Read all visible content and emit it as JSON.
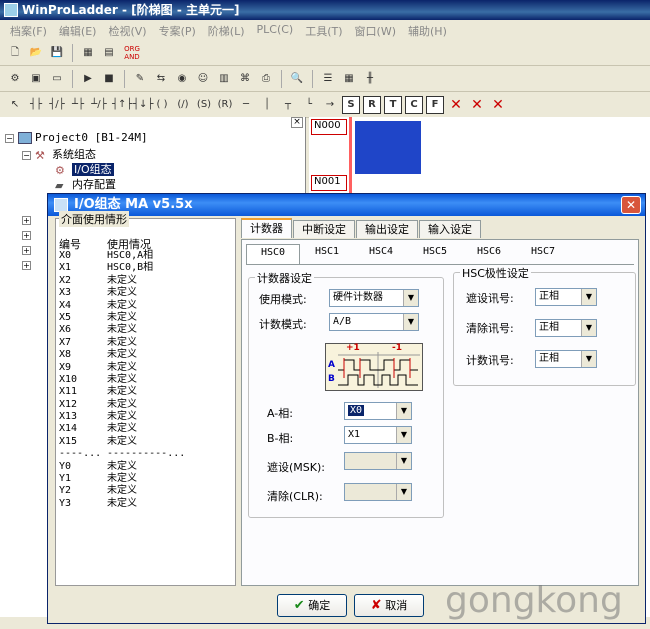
{
  "app": {
    "title": "WinProLadder - [阶梯图 - 主单元一]"
  },
  "menu": [
    "档案(F)",
    "编辑(E)",
    "检视(V)",
    "专案(P)",
    "阶梯(L)",
    "PLC(C)",
    "工具(T)",
    "窗口(W)",
    "辅助(H)"
  ],
  "toolbar3": {
    "b1": "S",
    "b2": "R",
    "b3": "T",
    "b4": "C",
    "b5": "F",
    "t_org": "ORG",
    "t_and": "AND"
  },
  "tree": {
    "project": "Project0  [B1-24M]",
    "system_config": "系统组态",
    "io_config": "I/O组态",
    "memory_config": "内存配置",
    "collapse": "□",
    "close": "×"
  },
  "ladder": {
    "n1": "N000",
    "n2": "N001"
  },
  "dialog": {
    "title": "I/O组态 MA v5.5x",
    "io_group_label": "介面使用情形",
    "col_no": "编号",
    "col_usage": "使用情况",
    "rows": [
      [
        "X0",
        "HSC0,A相"
      ],
      [
        "X1",
        "HSC0,B相"
      ],
      [
        "X2",
        "未定义"
      ],
      [
        "X3",
        "未定义"
      ],
      [
        "X4",
        "未定义"
      ],
      [
        "X5",
        "未定义"
      ],
      [
        "X6",
        "未定义"
      ],
      [
        "X7",
        "未定义"
      ],
      [
        "X8",
        "未定义"
      ],
      [
        "X9",
        "未定义"
      ],
      [
        "X10",
        "未定义"
      ],
      [
        "X11",
        "未定义"
      ],
      [
        "X12",
        "未定义"
      ],
      [
        "X13",
        "未定义"
      ],
      [
        "X14",
        "未定义"
      ],
      [
        "X15",
        "未定义"
      ],
      [
        "----...",
        "----------..."
      ],
      [
        "Y0",
        "未定义"
      ],
      [
        "Y1",
        "未定义"
      ],
      [
        "Y2",
        "未定义"
      ],
      [
        "Y3",
        "未定义"
      ]
    ],
    "tabs": [
      "计数器",
      "中断设定",
      "输出设定",
      "输入设定"
    ],
    "subtabs": [
      "HSC0",
      "HSC1",
      "HSC4",
      "HSC5",
      "HSC6",
      "HSC7"
    ],
    "counter_group": "计数器设定",
    "use_mode_label": "使用模式:",
    "use_mode_value": "硬件计数器",
    "count_mode_label": "计数模式:",
    "count_mode_value": "A/B",
    "wave_plus": "+1",
    "wave_minus": "-1",
    "wave_a": "A",
    "wave_b": "B",
    "a_phase_label": "A-相:",
    "a_phase_value": "X0",
    "b_phase_label": "B-相:",
    "b_phase_value": "X1",
    "mask_label": "遮设(MSK):",
    "clear_label": "清除(CLR):",
    "polarity_group": "HSC极性设定",
    "pol_mask_label": "遮设讯号:",
    "pol_mask_value": "正相",
    "pol_clear_label": "清除讯号:",
    "pol_clear_value": "正相",
    "pol_count_label": "计数讯号:",
    "pol_count_value": "正相",
    "ok": "确定",
    "cancel": "取消"
  },
  "watermark": "gongkong"
}
